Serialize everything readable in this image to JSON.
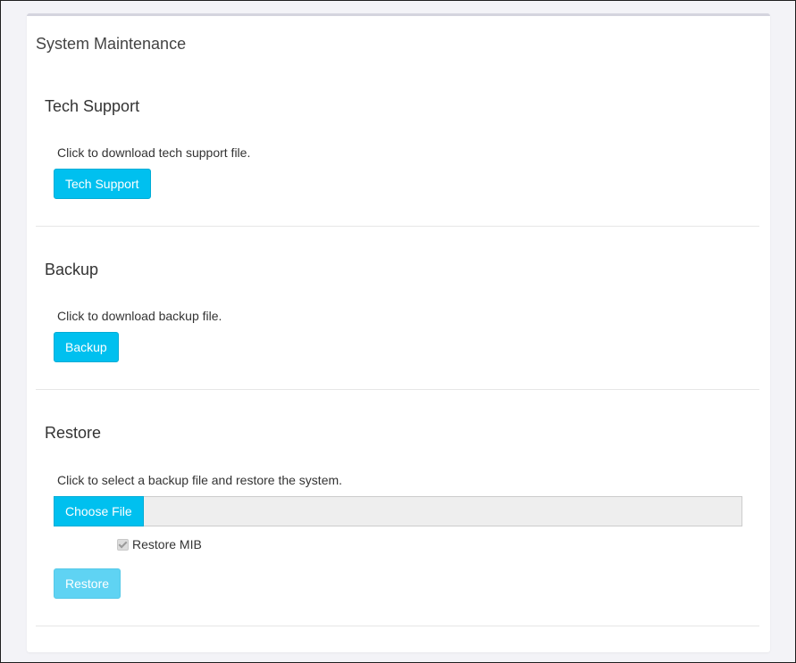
{
  "page": {
    "title": "System Maintenance"
  },
  "tech_support": {
    "heading": "Tech Support",
    "description": "Click to download tech support file.",
    "button_label": "Tech Support"
  },
  "backup": {
    "heading": "Backup",
    "description": "Click to download backup file.",
    "button_label": "Backup"
  },
  "restore": {
    "heading": "Restore",
    "description": "Click to select a backup file and restore the system.",
    "choose_file_label": "Choose File",
    "restore_mib_label": "Restore MIB",
    "restore_mib_checked": true,
    "restore_mib_disabled": true,
    "button_label": "Restore",
    "button_disabled": true
  },
  "colors": {
    "accent": "#00c0ef",
    "accent_disabled": "#5fd3f3",
    "panel_border": "#d4d4de",
    "background": "#f3f3f7"
  }
}
